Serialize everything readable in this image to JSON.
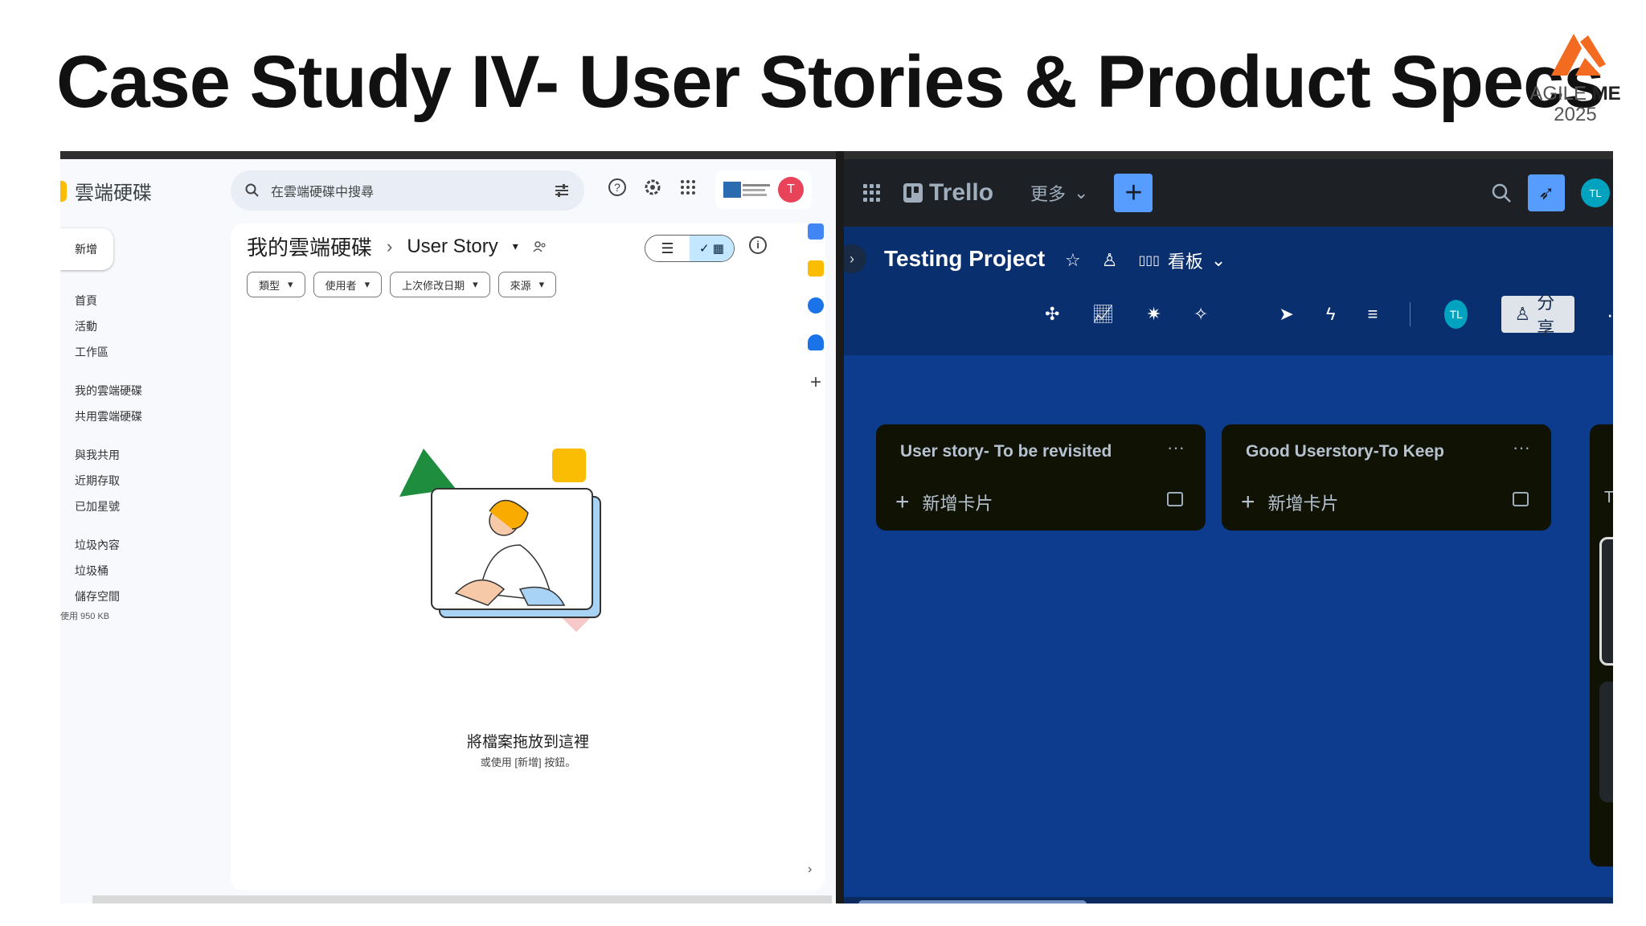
{
  "slide": {
    "title": "Case Study IV- User Stories & Product Specs",
    "logo_line1": "AGILE",
    "logo_line1_bold": "ME",
    "logo_year": "2025",
    "logo_color": "#f26b21"
  },
  "drive": {
    "app_name": "雲端硬碟",
    "search_placeholder": "在雲端硬碟中搜尋",
    "avatar_letter": "T",
    "new_label": "新增",
    "nav": {
      "home": "首頁",
      "activity": "活動",
      "workspace": "工作區",
      "my_drive": "我的雲端硬碟",
      "shared_drives": "共用雲端硬碟",
      "shared_with_me": "與我共用",
      "recent": "近期存取",
      "starred": "已加星號",
      "spam": "垃圾內容",
      "trash": "垃圾桶",
      "storage": "儲存空間",
      "storage_used": "使用 950 KB"
    },
    "breadcrumb_root": "我的雲端硬碟",
    "breadcrumb_folder": "User Story",
    "filters": [
      "類型",
      "使用者",
      "上次修改日期",
      "來源"
    ],
    "empty_title": "將檔案拖放到這裡",
    "empty_sub": "或使用 [新增] 按鈕。"
  },
  "trello": {
    "logo": "Trello",
    "more": "更多",
    "user_initials": "TL",
    "board_title": "Testing Project",
    "view_label": "看板",
    "share_label": "分享",
    "lists": [
      {
        "title": "User story- To be revisited",
        "add_card": "新增卡片"
      },
      {
        "title": "Good Userstory-To Keep",
        "add_card": "新增卡片"
      }
    ],
    "partial_list_text": "T"
  }
}
